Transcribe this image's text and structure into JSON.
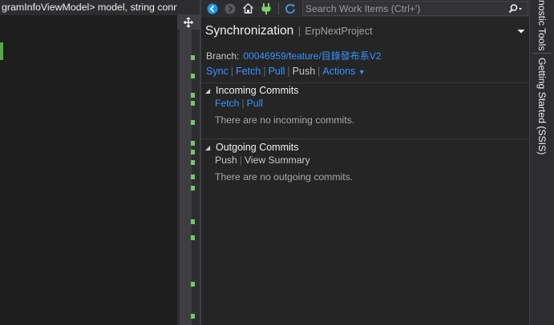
{
  "editor": {
    "signature_text": "gramInfoViewModel> model, string connec"
  },
  "toolbar": {
    "search_placeholder": "Search Work Items (Ctrl+')"
  },
  "panel": {
    "title": "Synchronization",
    "separator": "|",
    "project": "ErpNextProject",
    "branch_label": "Branch:",
    "branch_value": "00046959/feature/目錄發布系V2",
    "actions": {
      "sync": "Sync",
      "fetch": "Fetch",
      "pull": "Pull",
      "push": "Push",
      "actions": "Actions"
    },
    "incoming": {
      "heading": "Incoming Commits",
      "fetch": "Fetch",
      "pull": "Pull",
      "message": "There are no incoming commits."
    },
    "outgoing": {
      "heading": "Outgoing Commits",
      "push": "Push",
      "view_summary": "View Summary",
      "message": "There are no outgoing commits."
    }
  },
  "side_tabs": {
    "diagnostic_tools": "nostic Tools",
    "getting_started": "Getting Started (SSIS)"
  },
  "colors": {
    "link": "#3794ff",
    "background": "#252526",
    "toolbar": "#2d2d30",
    "change_marker": "#57a64a"
  }
}
